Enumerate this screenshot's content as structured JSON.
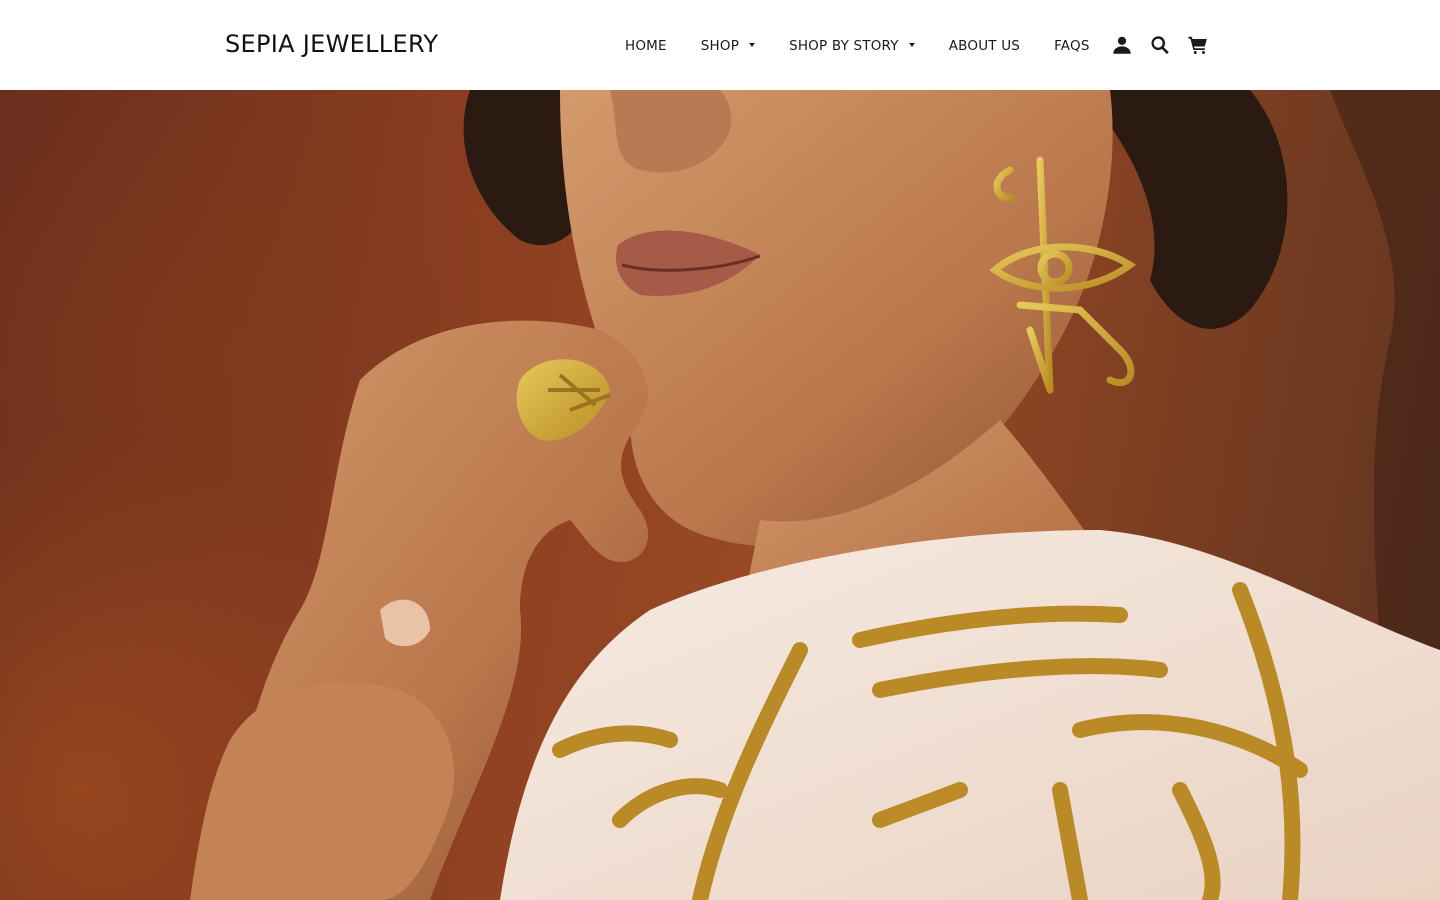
{
  "header": {
    "logo": "SEPIA JEWELLERY",
    "nav": [
      {
        "label": "HOME",
        "has_dropdown": false
      },
      {
        "label": "SHOP",
        "has_dropdown": true
      },
      {
        "label": "SHOP BY STORY",
        "has_dropdown": true
      },
      {
        "label": "ABOUT US",
        "has_dropdown": false
      },
      {
        "label": "FAQS",
        "has_dropdown": false
      }
    ],
    "icons": [
      "account-icon",
      "search-icon",
      "cart-icon"
    ]
  },
  "hero": {
    "image": "model-wearing-gold-eye-of-horus-earring-and-ring",
    "colors": {
      "background": "#8a3d20",
      "gold": "#c9a43a",
      "skin": "#c98a5e",
      "silk": "#f3e3d6"
    }
  }
}
